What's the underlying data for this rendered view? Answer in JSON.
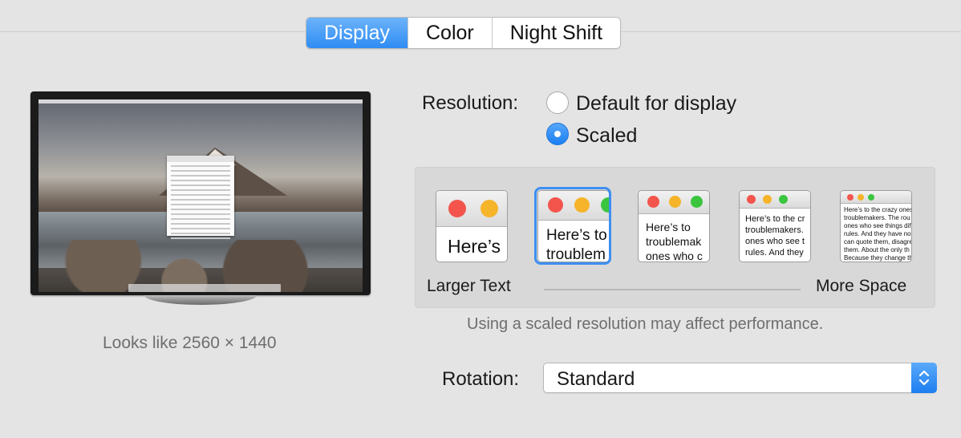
{
  "tabs": [
    {
      "label": "Display",
      "active": true
    },
    {
      "label": "Color",
      "active": false
    },
    {
      "label": "Night Shift",
      "active": false
    }
  ],
  "preview": {
    "looks_like": "Looks like 2560 × 1440"
  },
  "resolution": {
    "label": "Resolution:",
    "options": [
      {
        "label": "Default for display",
        "selected": false
      },
      {
        "label": "Scaled",
        "selected": true
      }
    ]
  },
  "scaled": {
    "thumbs": [
      {
        "text": "Here’s"
      },
      {
        "text": "Here’s to\ntroublem"
      },
      {
        "text": "Here’s to\ntroublemak\nones who c"
      },
      {
        "text": "Here’s to the cr\ntroublemakers.\nones who see t\nrules. And they"
      },
      {
        "text": "Here’s to the crazy ones\ntroublemakers. The rou\nones who see things dif\nrules. And they have no\ncan quote them, disagre\nthem. About the only th\nBecause they change th"
      }
    ],
    "selected_index": 1,
    "left_label": "Larger Text",
    "right_label": "More Space"
  },
  "performance_note": "Using a scaled resolution may affect performance.",
  "rotation": {
    "label": "Rotation:",
    "value": "Standard"
  },
  "colors": {
    "accent": "#2f8cf3",
    "background": "#e4e4e4"
  }
}
